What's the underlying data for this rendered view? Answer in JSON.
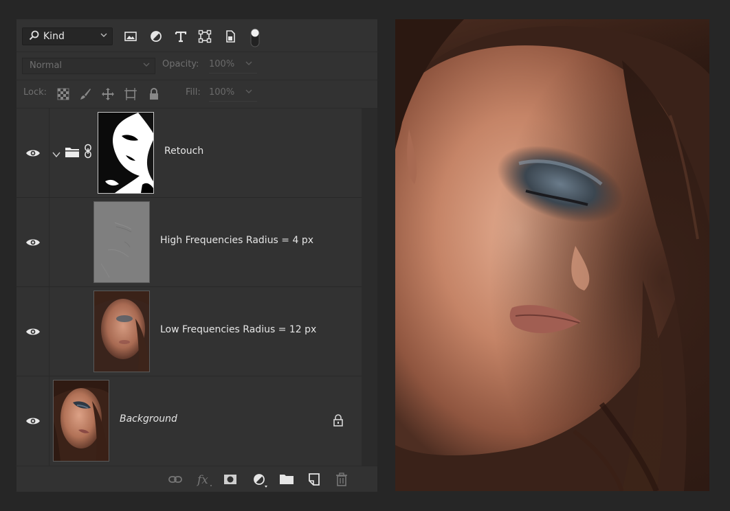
{
  "filter": {
    "kind_label": "Kind"
  },
  "blend": {
    "mode": "Normal",
    "opacity_label": "Opacity:",
    "opacity_value": "100%"
  },
  "lock": {
    "label": "Lock:",
    "fill_label": "Fill:",
    "fill_value": "100%"
  },
  "layers": [
    {
      "name": "Retouch",
      "type": "group",
      "visible": true
    },
    {
      "name": "High Frequencies Radius = 4 px",
      "type": "layer",
      "visible": true
    },
    {
      "name": "Low Frequencies Radius = 12 px",
      "type": "layer",
      "visible": true
    },
    {
      "name": "Background",
      "type": "background",
      "visible": true,
      "locked": true
    }
  ]
}
